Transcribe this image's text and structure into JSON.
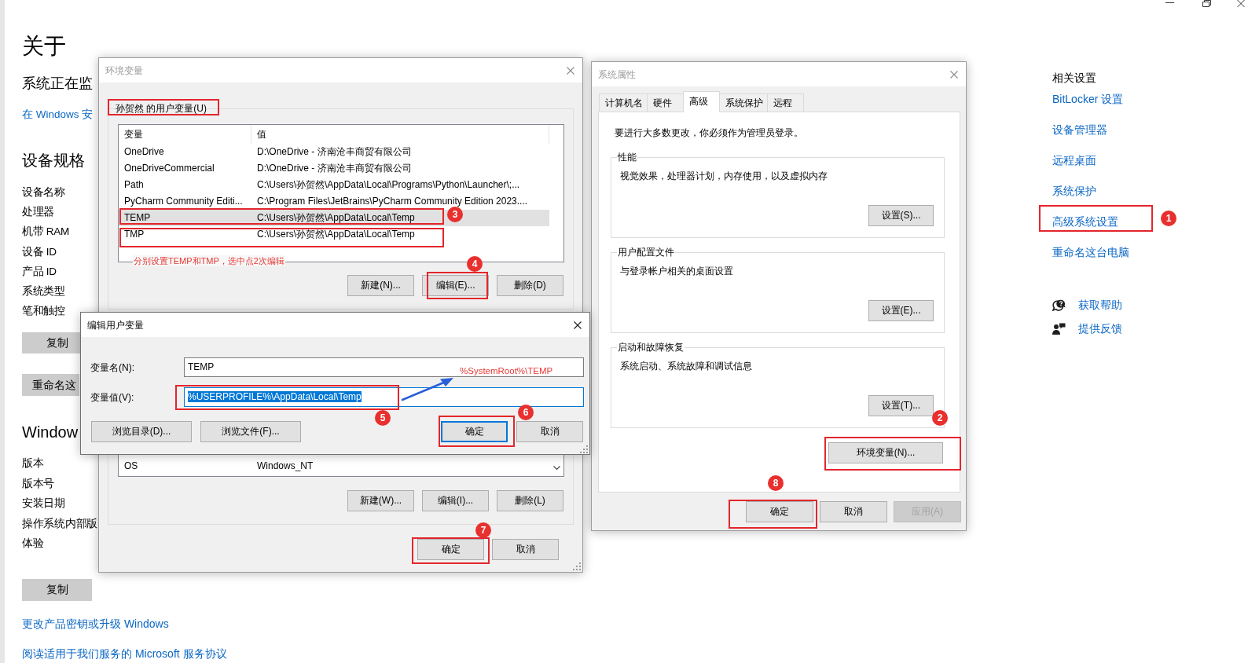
{
  "settings_page": {
    "title": "关于",
    "subtitle": "系统正在监",
    "security_link": "在 Windows 安",
    "device_specs": {
      "heading": "设备规格",
      "labels": [
        "设备名称",
        "处理器",
        "机带 RAM",
        "设备 ID",
        "产品 ID",
        "系统类型",
        "笔和触控"
      ],
      "copy_button": "复制",
      "rename_button": "重命名这"
    },
    "windows_specs": {
      "heading": "Window",
      "labels": [
        "版本",
        "版本号",
        "安装日期",
        "操作系统内部版",
        "体验"
      ],
      "copy_button": "复制"
    },
    "footer_links": [
      "更改产品密钥或升级 Windows",
      "阅读适用于我们服务的 Microsoft 服务协议"
    ],
    "related_settings": {
      "heading": "相关设置",
      "links": [
        {
          "label": "BitLocker 设置",
          "highlighted": false
        },
        {
          "label": "设备管理器",
          "highlighted": false
        },
        {
          "label": "远程桌面",
          "highlighted": false
        },
        {
          "label": "系统保护",
          "highlighted": false
        },
        {
          "label": "高级系统设置",
          "highlighted": true,
          "step": "1"
        },
        {
          "label": "重命名这台电脑",
          "highlighted": false
        }
      ]
    },
    "support_links": [
      {
        "kind": "help",
        "label": "获取帮助"
      },
      {
        "kind": "feedback",
        "label": "提供反馈"
      }
    ]
  },
  "environment_variables": {
    "title": "环境变量",
    "active": false,
    "user_variables": {
      "label": {
        "text": "孙贺然 的用户变量(U)",
        "highlighted": true
      },
      "columns": [
        "变量",
        "值"
      ],
      "rows": [
        {
          "name": "OneDrive",
          "value": "D:\\OneDrive - 济南沧丰商贸有限公司",
          "selected": false,
          "highlighted": false
        },
        {
          "name": "OneDriveCommercial",
          "value": "D:\\OneDrive - 济南沧丰商贸有限公司",
          "selected": false,
          "highlighted": false
        },
        {
          "name": "Path",
          "value": "C:\\Users\\孙贺然\\AppData\\Local\\Programs\\Python\\Launcher\\;...",
          "selected": false,
          "highlighted": false
        },
        {
          "name": "PyCharm Community Editi...",
          "value": "C:\\Program Files\\JetBrains\\PyCharm Community Edition 2023....",
          "selected": false,
          "highlighted": false
        },
        {
          "name": "TEMP",
          "value": "C:\\Users\\孙贺然\\AppData\\Local\\Temp",
          "selected": true,
          "highlighted": true,
          "step": "3"
        },
        {
          "name": "TMP",
          "value": "C:\\Users\\孙贺然\\AppData\\Local\\Temp",
          "selected": false,
          "highlighted": true
        }
      ],
      "note": "分别设置TEMP和TMP，选中点2次编辑",
      "buttons": [
        {
          "label": "新建(N)...",
          "highlighted": false
        },
        {
          "label": "编辑(E)...",
          "highlighted": true,
          "step": "4"
        },
        {
          "label": "删除(D)",
          "highlighted": false
        }
      ]
    },
    "system_variables": {
      "rows": [
        {
          "name": "OS",
          "value": "Windows_NT",
          "selected": false
        }
      ],
      "buttons": [
        "新建(W)...",
        "编辑(I)...",
        "删除(L)"
      ]
    },
    "buttons": [
      {
        "label": "确定",
        "highlighted": true,
        "step": "7"
      },
      {
        "label": "取消",
        "highlighted": false
      }
    ]
  },
  "edit_user_variable": {
    "title": "编辑用户变量",
    "active": true,
    "fields": [
      {
        "label": "变量名(N):",
        "value": "TEMP",
        "focused": false,
        "selected": false,
        "highlighted": false
      },
      {
        "label": "变量值(V):",
        "value": "%USERPROFILE%\\AppData\\Local\\Temp",
        "focused": true,
        "selected": true,
        "highlighted": true,
        "step": "5"
      }
    ],
    "annotation": "%SystemRoot%\\TEMP",
    "browse_buttons": [
      "浏览目录(D)...",
      "浏览文件(F)..."
    ],
    "buttons": [
      {
        "label": "确定",
        "default": true,
        "highlighted": true,
        "step": "6"
      },
      {
        "label": "取消",
        "default": false,
        "highlighted": false
      }
    ]
  },
  "system_properties": {
    "title": "系统属性",
    "active": false,
    "tabs": [
      {
        "label": "计算机名",
        "selected": false
      },
      {
        "label": "硬件",
        "selected": false
      },
      {
        "label": "高级",
        "selected": true
      },
      {
        "label": "系统保护",
        "selected": false
      },
      {
        "label": "远程",
        "selected": false
      }
    ],
    "admin_note": "要进行大多数更改，你必须作为管理员登录。",
    "groups": [
      {
        "title": "性能",
        "description": "视觉效果，处理器计划，内存使用，以及虚拟内存",
        "button": "设置(S)..."
      },
      {
        "title": "用户配置文件",
        "description": "与登录帐户相关的桌面设置",
        "button": "设置(E)..."
      },
      {
        "title": "启动和故障恢复",
        "description": "系统启动、系统故障和调试信息",
        "button": "设置(T)..."
      }
    ],
    "environment_button": {
      "label": "环境变量(N)...",
      "highlighted": true,
      "step": "2"
    },
    "buttons": [
      {
        "label": "确定",
        "disabled": false,
        "highlighted": true,
        "step": "8"
      },
      {
        "label": "取消",
        "disabled": false,
        "highlighted": false
      },
      {
        "label": "应用(A)",
        "disabled": true,
        "highlighted": false
      }
    ]
  }
}
